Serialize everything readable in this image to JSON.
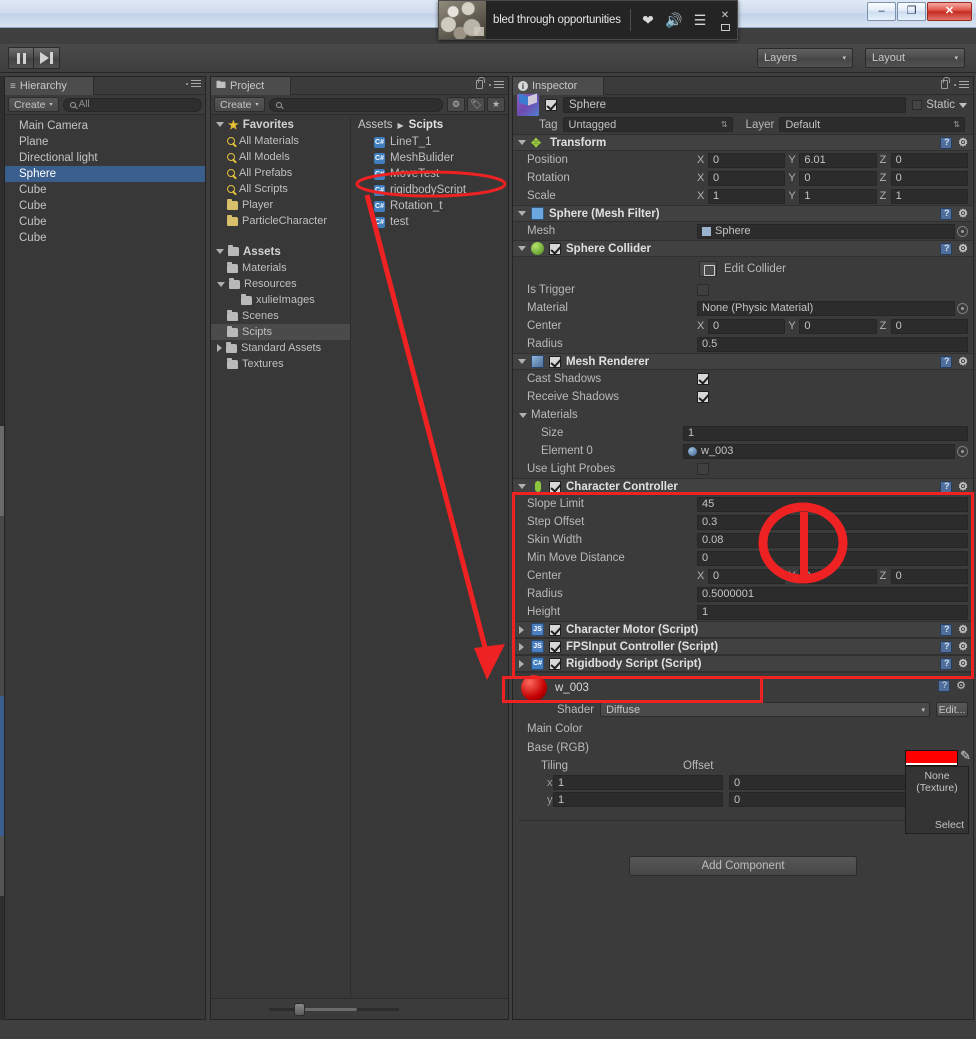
{
  "os_window": {
    "minimize_label": "–",
    "maximize_label": "❐",
    "close_label": "✕"
  },
  "media_player": {
    "title": "bled through opportunities",
    "heart_icon": "heart-icon",
    "volume_icon": "volume-icon",
    "playlist_icon": "playlist-icon",
    "close_label": "✕"
  },
  "toolbar": {
    "pause_button": "pause-button",
    "step_button": "step-button",
    "layers_label": "Layers",
    "layout_label": "Layout",
    "dropdown_arrow": "▾"
  },
  "hierarchy": {
    "tab_label": "Hierarchy",
    "create_label": "Create",
    "create_arrow": "▾",
    "search_placeholder": "All",
    "items": [
      {
        "label": "Main Camera",
        "selected": false
      },
      {
        "label": "Plane",
        "selected": false
      },
      {
        "label": "Directional light",
        "selected": false
      },
      {
        "label": "Sphere",
        "selected": true
      },
      {
        "label": "Cube",
        "selected": false
      },
      {
        "label": "Cube",
        "selected": false
      },
      {
        "label": "Cube",
        "selected": false
      },
      {
        "label": "Cube",
        "selected": false
      }
    ]
  },
  "project": {
    "tab_label": "Project",
    "create_label": "Create",
    "create_arrow": "▾",
    "search_placeholder": "",
    "favorites_label": "Favorites",
    "favorites": [
      {
        "label": "All Materials",
        "icon": "search-icon"
      },
      {
        "label": "All Models",
        "icon": "search-icon"
      },
      {
        "label": "All Prefabs",
        "icon": "search-icon"
      },
      {
        "label": "All Scripts",
        "icon": "search-icon"
      },
      {
        "label": "Player",
        "icon": "folder-icon"
      },
      {
        "label": "ParticleCharacter",
        "icon": "folder-icon"
      }
    ],
    "assets_label": "Assets",
    "tree": [
      {
        "label": "Materials",
        "indent": 1,
        "selected": false,
        "expandable": false
      },
      {
        "label": "Resources",
        "indent": 1,
        "selected": false,
        "expandable": true,
        "expanded": true
      },
      {
        "label": "xulieImages",
        "indent": 2,
        "selected": false,
        "expandable": false
      },
      {
        "label": "Scenes",
        "indent": 1,
        "selected": false,
        "expandable": false
      },
      {
        "label": "Scipts",
        "indent": 1,
        "selected": true,
        "expandable": false
      },
      {
        "label": "Standard Assets",
        "indent": 1,
        "selected": false,
        "expandable": true,
        "expanded": false
      },
      {
        "label": "Textures",
        "indent": 1,
        "selected": false,
        "expandable": false
      }
    ],
    "breadcrumb_root": "Assets",
    "breadcrumb_sep": "▶",
    "breadcrumb_current": "Scipts",
    "assets": [
      {
        "label": "LineT_1",
        "icon": "csharp-script-icon"
      },
      {
        "label": "MeshBulider",
        "icon": "csharp-script-icon"
      },
      {
        "label": "MoveTest",
        "icon": "csharp-script-icon"
      },
      {
        "label": "rigidbodyScript",
        "icon": "csharp-script-icon",
        "annotated": true
      },
      {
        "label": "Rotation_t",
        "icon": "csharp-script-icon"
      },
      {
        "label": "test",
        "icon": "csharp-script-icon"
      }
    ]
  },
  "inspector": {
    "tab_label": "Inspector",
    "object_name": "Sphere",
    "object_enabled": true,
    "static_label": "Static",
    "tag_label": "Tag",
    "tag_value": "Untagged",
    "layer_label": "Layer",
    "layer_value": "Default",
    "transform": {
      "title": "Transform",
      "position_label": "Position",
      "position": {
        "x": "0",
        "y": "6.01",
        "z": "0"
      },
      "rotation_label": "Rotation",
      "rotation": {
        "x": "0",
        "y": "0",
        "z": "0"
      },
      "scale_label": "Scale",
      "scale": {
        "x": "1",
        "y": "1",
        "z": "1"
      }
    },
    "mesh_filter": {
      "title": "Sphere (Mesh Filter)",
      "mesh_label": "Mesh",
      "mesh_value": "Sphere"
    },
    "sphere_collider": {
      "title": "Sphere Collider",
      "enabled": true,
      "edit_collider_label": "Edit Collider",
      "is_trigger_label": "Is Trigger",
      "is_trigger_value": false,
      "material_label": "Material",
      "material_value": "None (Physic Material)",
      "center_label": "Center",
      "center": {
        "x": "0",
        "y": "0",
        "z": "0"
      },
      "radius_label": "Radius",
      "radius_value": "0.5"
    },
    "mesh_renderer": {
      "title": "Mesh Renderer",
      "enabled": true,
      "cast_shadows_label": "Cast Shadows",
      "cast_shadows_value": true,
      "receive_shadows_label": "Receive Shadows",
      "receive_shadows_value": true,
      "materials_label": "Materials",
      "size_label": "Size",
      "size_value": "1",
      "element0_label": "Element 0",
      "element0_value": "w_003",
      "use_light_probes_label": "Use Light Probes",
      "use_light_probes_value": false
    },
    "character_controller": {
      "title": "Character Controller",
      "enabled": true,
      "slope_limit_label": "Slope Limit",
      "slope_limit_value": "45",
      "step_offset_label": "Step Offset",
      "step_offset_value": "0.3",
      "skin_width_label": "Skin Width",
      "skin_width_value": "0.08",
      "min_move_label": "Min Move Distance",
      "min_move_value": "0",
      "center_label": "Center",
      "center": {
        "x": "0",
        "y": "0",
        "z": "0"
      },
      "radius_label": "Radius",
      "radius_value": "0.5000001",
      "height_label": "Height",
      "height_value": "1"
    },
    "scripts": [
      {
        "title": "Character Motor (Script)",
        "enabled": true,
        "icon": "js-script-icon"
      },
      {
        "title": "FPSInput Controller (Script)",
        "enabled": true,
        "icon": "js-script-icon"
      },
      {
        "title": "Rigidbody Script (Script)",
        "enabled": true,
        "icon": "csharp-script-icon"
      }
    ],
    "material": {
      "name": "w_003",
      "shader_label": "Shader",
      "shader_value": "Diffuse",
      "edit_label": "Edit...",
      "main_color_label": "Main Color",
      "main_color_hex": "#ff0000",
      "base_rgb_label": "Base (RGB)",
      "tiling_label": "Tiling",
      "offset_label": "Offset",
      "x_label": "x",
      "y_label": "y",
      "tiling_x": "1",
      "tiling_y": "1",
      "offset_x": "0",
      "offset_y": "0",
      "texture_none_line1": "None",
      "texture_none_line2": "(Texture)",
      "texture_select_label": "Select"
    },
    "add_component_label": "Add Component"
  },
  "annotations": {
    "ellipse_target": "rigidbodyScript",
    "arrow_color": "#ee2222",
    "rect_color": "#ee2222",
    "circled_value_note": "Character Controller values circled"
  }
}
